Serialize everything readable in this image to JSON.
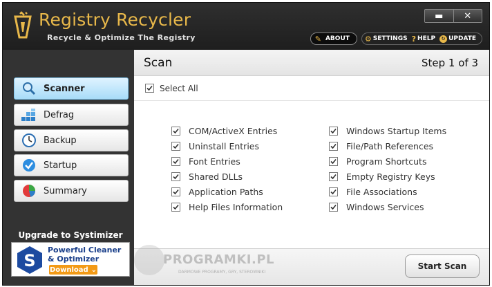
{
  "app": {
    "title": "Registry Recycler",
    "subtitle": "Recycle & Optimize The Registry"
  },
  "window_controls": {
    "minimize": "▬",
    "close": "✕"
  },
  "top_nav": {
    "about": "ABOUT",
    "settings": "SETTINGS",
    "help": "HELP",
    "update": "UPDATE"
  },
  "sidebar": {
    "items": [
      {
        "label": "Scanner",
        "icon": "magnifier-icon",
        "active": true
      },
      {
        "label": "Defrag",
        "icon": "defrag-blocks-icon",
        "active": false
      },
      {
        "label": "Backup",
        "icon": "clock-icon",
        "active": false
      },
      {
        "label": "Startup",
        "icon": "checkmark-circle-icon",
        "active": false
      },
      {
        "label": "Summary",
        "icon": "pie-chart-icon",
        "active": false
      }
    ],
    "upgrade": {
      "title": "Upgrade to Systimizer",
      "line1": "Powerful Cleaner",
      "line2": "& Optimizer",
      "download": "Download"
    }
  },
  "main": {
    "title": "Scan",
    "step": "Step 1 of 3",
    "select_all": "Select All",
    "left_options": [
      "COM/ActiveX Entries",
      "Uninstall Entries",
      "Font Entries",
      "Shared DLLs",
      "Application Paths",
      "Help Files Information"
    ],
    "right_options": [
      "Windows Startup Items",
      "File/Path References",
      "Program Shortcuts",
      "Empty Registry Keys",
      "File Associations",
      "Windows Services"
    ],
    "start_scan": "Start Scan"
  },
  "watermark": {
    "text": "PROGRAMKI.PL",
    "sub": "DARMOWE PROGRAMY, GRY, STEROWNIKI"
  },
  "colors": {
    "accent": "#e8b84a",
    "active_nav": "#a8dcf8",
    "download": "#f39a16"
  }
}
